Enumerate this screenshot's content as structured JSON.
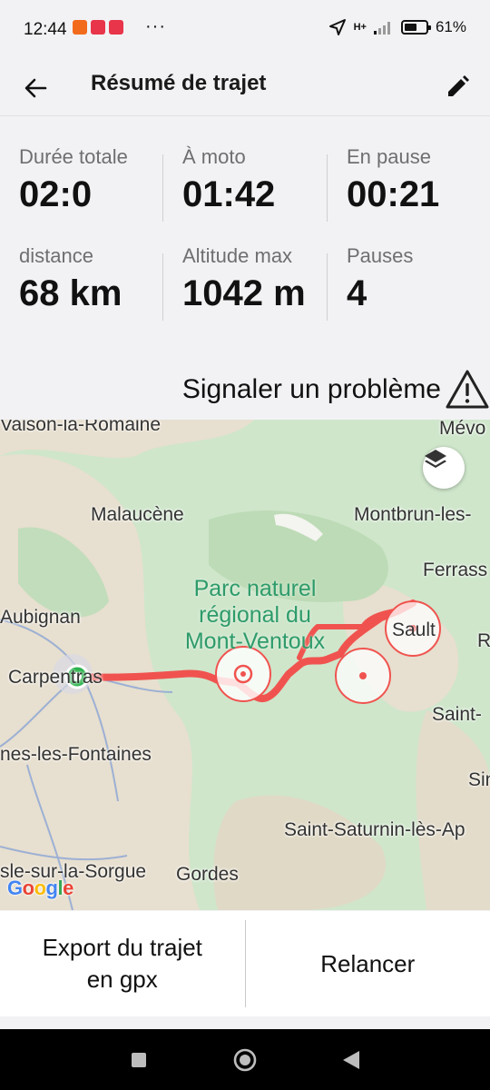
{
  "status_bar": {
    "time": "12:44",
    "dots": "···",
    "network": "H+",
    "battery_percent": "61%",
    "battery_level": 0.61
  },
  "app_bar": {
    "title": "Résumé de trajet"
  },
  "stats": [
    {
      "label": "Durée totale",
      "value": "02:0"
    },
    {
      "label": "À moto",
      "value": "01:42"
    },
    {
      "label": "En pause",
      "value": "00:21"
    },
    {
      "label": "distance",
      "value": "68 km"
    },
    {
      "label": "Altitude max",
      "value": "1042 m"
    },
    {
      "label": "Pauses",
      "value": "4"
    }
  ],
  "report": {
    "label": "Signaler un problème",
    "icon": "warning-icon"
  },
  "map": {
    "park_label": "Parc naturel régional du Mont-Ventoux",
    "places": [
      "Vaison-la-Romaine",
      "Mévo",
      "Malaucène",
      "Montbrun-les-",
      "Ferrass",
      "Aubignan",
      "Carpentras",
      "Sault",
      "R",
      "Saint-",
      "nes-les-Fontaines",
      "Sin",
      "Saint-Saturnin-lès-Ap",
      "sle-sur-la-Sorgue",
      "Gordes"
    ],
    "google_letters": [
      "G",
      "o",
      "o",
      "g",
      "l",
      "e"
    ],
    "colors": {
      "route": "#f0534f",
      "start": "#2bb24c",
      "park": "#2e9b6a"
    }
  },
  "actions": {
    "export_line1": "Export du trajet",
    "export_line2": "en gpx",
    "relaunch": "Relancer"
  },
  "colors": {
    "background": "#f2f2f4",
    "label": "#6f6f72",
    "value": "#111111"
  }
}
